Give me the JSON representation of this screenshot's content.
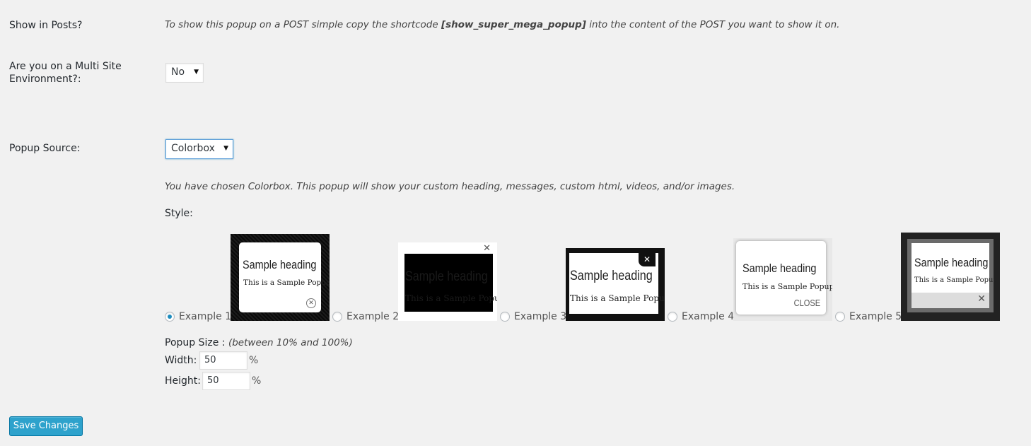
{
  "show_in_posts": {
    "label": "Show in Posts?",
    "desc_pre": "To show this popup on a POST simple copy the shortcode ",
    "shortcode": "[show_super_mega_popup]",
    "desc_post": " into the content of the POST you want to show it on."
  },
  "multisite": {
    "label_line1": "Are you on a Multi Site",
    "label_line2": "Environment?:",
    "value": "No"
  },
  "popup_source": {
    "label": "Popup Source:",
    "value": "Colorbox",
    "desc": "You have chosen Colorbox. This popup will show your custom heading, messages, custom html, videos, and/or images."
  },
  "style": {
    "label": "Style:",
    "selected_index": 0,
    "examples": [
      {
        "label": "Example 1",
        "heading": "Sample heading",
        "text": "This is a Sample Popup"
      },
      {
        "label": "Example 2",
        "heading": "Sample heading",
        "text": "This is a Sample Popup"
      },
      {
        "label": "Example 3",
        "heading": "Sample heading",
        "text": "This is a Sample Popup"
      },
      {
        "label": "Example 4",
        "heading": "Sample heading",
        "text": "This is a Sample Popup",
        "close": "CLOSE"
      },
      {
        "label": "Example 5",
        "heading": "Sample heading",
        "text": "This is a Sample Popup"
      }
    ]
  },
  "popup_size": {
    "label": "Popup Size :",
    "hint": "(between 10% and 100%)",
    "width_label": "Width:",
    "width_value": "50",
    "height_label": "Height:",
    "height_value": "50",
    "unit": "%"
  },
  "save_button": "Save Changes",
  "colors": {
    "accent": "#2ea2cc",
    "focus": "#5b9dd9",
    "background": "#f1f1f1"
  }
}
